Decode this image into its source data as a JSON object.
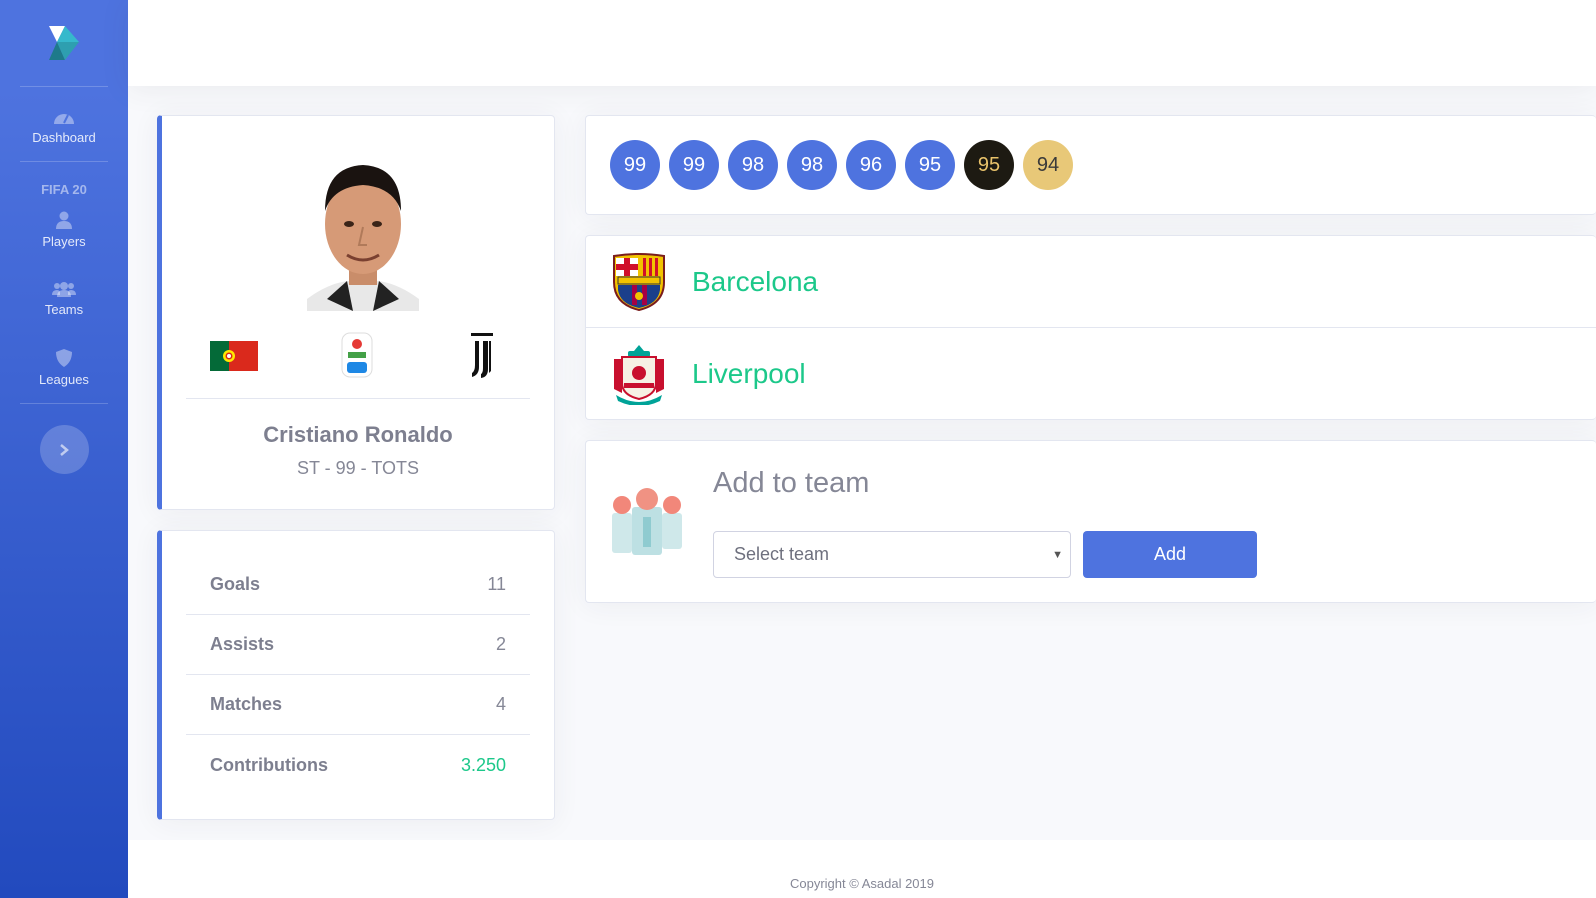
{
  "sidebar": {
    "nav": [
      {
        "label": "Dashboard",
        "icon": "dashboard-icon"
      },
      {
        "label": "Players",
        "icon": "user-icon"
      },
      {
        "label": "Teams",
        "icon": "users-icon"
      },
      {
        "label": "Leagues",
        "icon": "shield-icon"
      }
    ],
    "heading": "FIFA 20",
    "toggle_icon": "chevron-right-icon"
  },
  "player": {
    "name": "Cristiano Ronaldo",
    "subtitle": "ST - 99 - TOTS",
    "nation": "Portugal",
    "league": "Serie A TIM",
    "club": "Juventus"
  },
  "stats": [
    {
      "label": "Goals",
      "value": "11"
    },
    {
      "label": "Assists",
      "value": "2"
    },
    {
      "label": "Matches",
      "value": "4"
    },
    {
      "label": "Contributions",
      "value": "3.250"
    }
  ],
  "ratings": [
    {
      "value": "99",
      "bg": "#4e73df",
      "fg": "#ffffff"
    },
    {
      "value": "99",
      "bg": "#4e73df",
      "fg": "#ffffff"
    },
    {
      "value": "98",
      "bg": "#4e73df",
      "fg": "#ffffff"
    },
    {
      "value": "98",
      "bg": "#4e73df",
      "fg": "#ffffff"
    },
    {
      "value": "96",
      "bg": "#4e73df",
      "fg": "#ffffff"
    },
    {
      "value": "95",
      "bg": "#4e73df",
      "fg": "#ffffff"
    },
    {
      "value": "95",
      "bg": "#1d1a12",
      "fg": "#e8c26a"
    },
    {
      "value": "94",
      "bg": "#e8c878",
      "fg": "#3a3a3a"
    }
  ],
  "teams": [
    {
      "name": "Barcelona"
    },
    {
      "name": "Liverpool"
    }
  ],
  "add_to_team": {
    "title": "Add to team",
    "select_placeholder": "Select team",
    "button": "Add"
  },
  "footer": {
    "text": "Copyright © Asadal 2019"
  },
  "colors": {
    "primary": "#4e73df",
    "success": "#1cc88a"
  }
}
